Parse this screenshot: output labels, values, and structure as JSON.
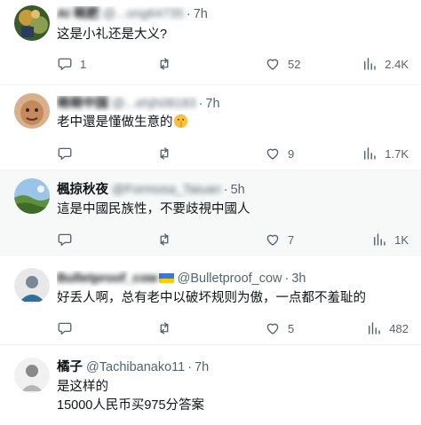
{
  "colors": {
    "text": "#0f1419",
    "secondary": "#536471",
    "divider": "#eff3f4",
    "highlight_bg": "#f7f9f9"
  },
  "icons": {
    "reply": "speech-bubble-icon",
    "retweet": "retweet-icon",
    "like": "heart-icon",
    "views": "bar-chart-icon"
  },
  "tweets": [
    {
      "name": "AI 萌肥",
      "handle": "@...ong64735",
      "dot": "·",
      "time": "7h",
      "text": "这是小礼还是大义?",
      "replies": "1",
      "retweets": "",
      "likes": "52",
      "views": "2.4K"
    },
    {
      "name": "萌萌中国",
      "handle": "@...ehjh08183",
      "dot": "·",
      "time": "7h",
      "text": "老中還是懂做生意的",
      "emoji": "shushing-face-emoji",
      "replies": "",
      "retweets": "",
      "likes": "9",
      "views": "1.7K"
    },
    {
      "name": "楓掠秋夜",
      "handle": "@Formosa_Taiuan",
      "dot": "·",
      "time": "5h",
      "text": "這是中國民族性，不要歧視中國人",
      "replies": "",
      "retweets": "",
      "likes": "7",
      "views": "1K"
    },
    {
      "name": "Bulletproof_cow",
      "handle": "@Bulletproof_cow",
      "dot": "·",
      "time": "3h",
      "text": "好丢人啊，总有老中以破坏规则为傲，一点都不羞耻的",
      "replies": "",
      "retweets": "",
      "likes": "5",
      "views": "482"
    },
    {
      "name": "橘子",
      "handle": "@Tachibanako11",
      "dot": "·",
      "time": "7h",
      "text": "是这样的\n15000人民币买975分答案"
    }
  ]
}
